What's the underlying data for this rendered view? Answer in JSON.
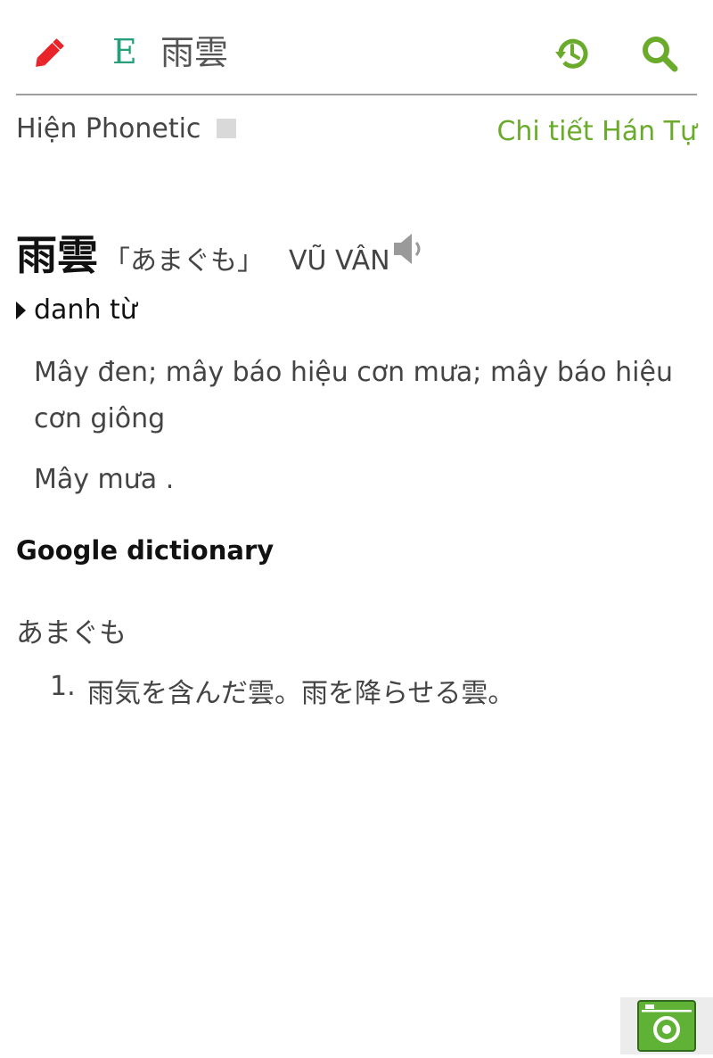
{
  "header": {
    "edit_icon": "pencil-icon",
    "lang_letter": "E",
    "search_word": "雨雲",
    "history_icon": "history-icon",
    "search_icon": "search-icon"
  },
  "options": {
    "phonetic_label": "Hiện Phonetic",
    "phonetic_checked": false,
    "kanji_detail_link": "Chi tiết Hán Tự"
  },
  "entry": {
    "word": "雨雲",
    "reading": "「あまぐも」",
    "han_viet": "VŨ VÂN",
    "speaker_icon": "speaker-icon",
    "part_of_speech": "danh từ",
    "meanings": [
      "Mây đen; mây báo hiệu cơn mưa; mây báo hiệu cơn giông",
      "Mây mưa ."
    ]
  },
  "google": {
    "title": "Google dictionary",
    "reading": "あまぐも",
    "definitions": [
      {
        "num": "1.",
        "text": "雨気を含んだ雲。雨を降らせる雲。"
      }
    ]
  },
  "footer": {
    "camera_icon": "camera-icon"
  },
  "colors": {
    "accent_green": "#6aab2c",
    "lang_green": "#26a07c",
    "edit_red": "#e8232a"
  }
}
